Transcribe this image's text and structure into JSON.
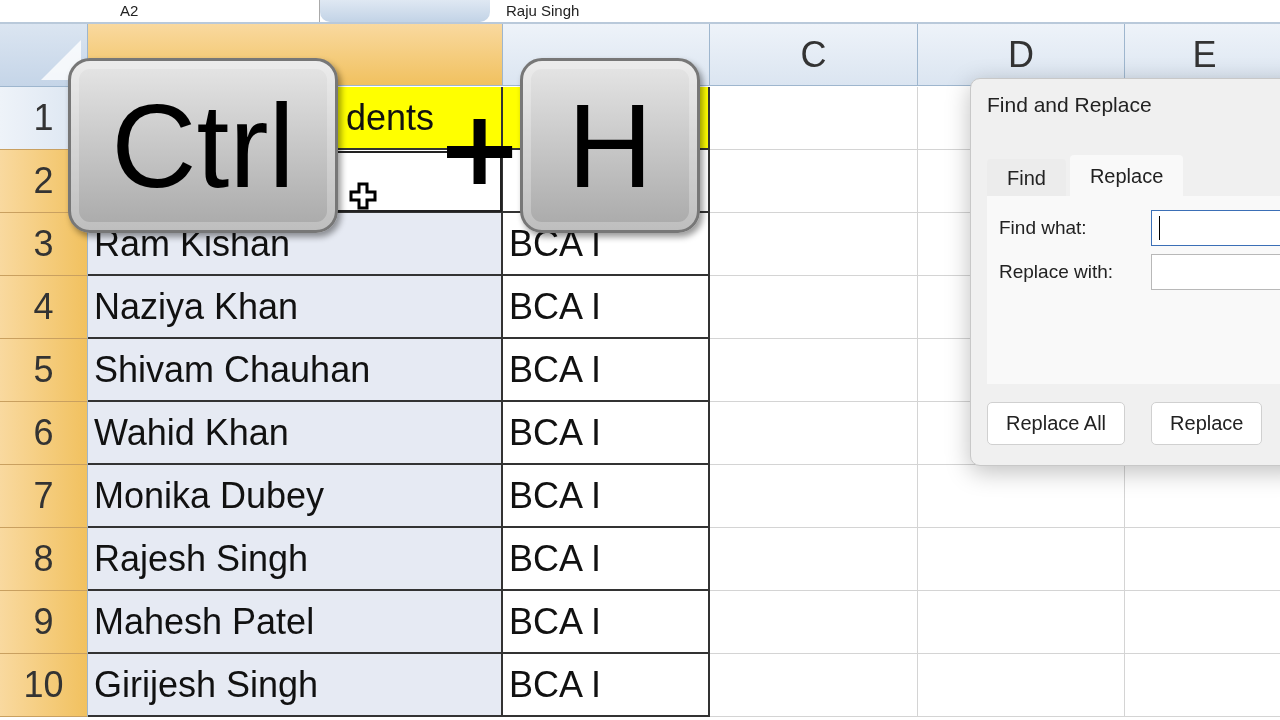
{
  "formula_bar": {
    "name_box": "A2",
    "formula": "Raju Singh"
  },
  "columns": [
    {
      "selected": true
    },
    {
      "selected": false
    },
    {
      "label": "C",
      "selected": false
    },
    {
      "label": "D",
      "selected": false
    },
    {
      "label": "E",
      "selected": false
    }
  ],
  "rows": [
    {
      "number": "1",
      "selected": false,
      "kind": "header",
      "cells": [
        {
          "text": "dents"
        },
        {
          "active": false
        }
      ]
    },
    {
      "number": "2",
      "selected": true,
      "kind": "data",
      "cells": [
        {
          "active": true
        },
        {
          "active": false
        }
      ]
    },
    {
      "number": "3",
      "selected": true,
      "kind": "data",
      "cells": [
        {
          "text": "Ram Kishan"
        },
        {
          "text": "BCA I"
        }
      ]
    },
    {
      "number": "4",
      "selected": true,
      "kind": "data",
      "cells": [
        {
          "text": "Naziya Khan"
        },
        {
          "text": "BCA I"
        }
      ]
    },
    {
      "number": "5",
      "selected": true,
      "kind": "data",
      "cells": [
        {
          "text": "Shivam Chauhan"
        },
        {
          "text": "BCA I"
        }
      ]
    },
    {
      "number": "6",
      "selected": true,
      "kind": "data",
      "cells": [
        {
          "text": "Wahid Khan"
        },
        {
          "text": "BCA I"
        }
      ]
    },
    {
      "number": "7",
      "selected": true,
      "kind": "data",
      "cells": [
        {
          "text": "Monika Dubey"
        },
        {
          "text": "BCA I"
        }
      ]
    },
    {
      "number": "8",
      "selected": true,
      "kind": "data",
      "cells": [
        {
          "text": "Rajesh Singh"
        },
        {
          "text": "BCA I"
        }
      ]
    },
    {
      "number": "9",
      "selected": true,
      "kind": "data",
      "cells": [
        {
          "text": "Mahesh Patel"
        },
        {
          "text": "BCA I"
        }
      ]
    },
    {
      "number": "10",
      "selected": true,
      "kind": "data",
      "cells": [
        {
          "text": "Girijesh Singh"
        },
        {
          "text": "BCA I"
        }
      ]
    }
  ],
  "shortcut": {
    "keys": [
      "Ctrl",
      "H"
    ],
    "separator": "+"
  },
  "dialog": {
    "title": "Find and Replace",
    "tabs": [
      {
        "label": "Find",
        "selected": false
      },
      {
        "label": "Replace",
        "selected": true
      }
    ],
    "fields": [
      {
        "label": "Find what:",
        "focused": true
      },
      {
        "label": "Replace with:",
        "focused": false
      }
    ],
    "buttons": [
      "Replace All",
      "Replace"
    ]
  }
}
